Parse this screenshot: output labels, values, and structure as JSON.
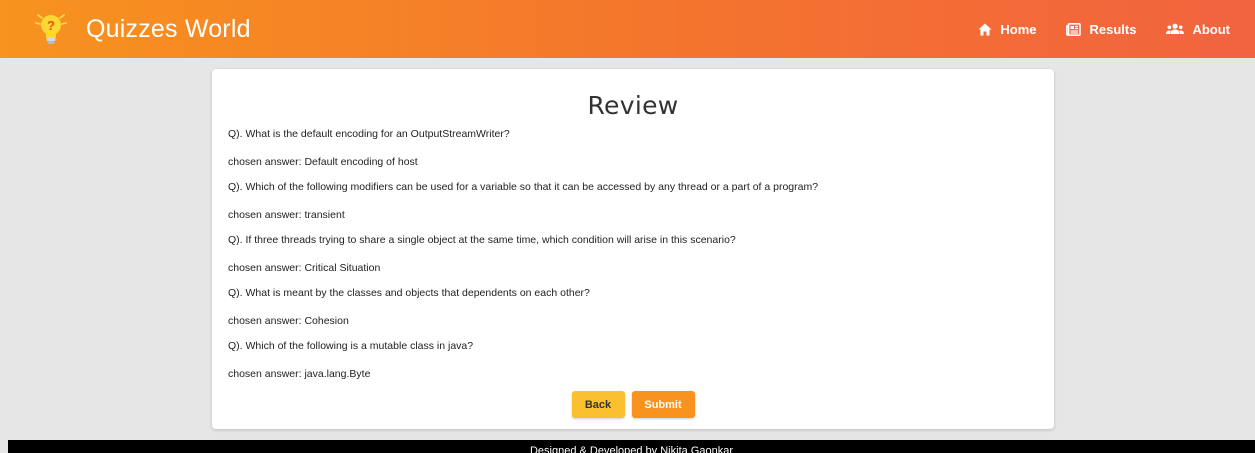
{
  "navbar": {
    "brand": "Quizzes World",
    "logo_icon": "lightbulb-question-icon",
    "links": [
      {
        "label": "Home",
        "icon": "home-icon"
      },
      {
        "label": "Results",
        "icon": "newspaper-icon"
      },
      {
        "label": "About",
        "icon": "users-icon"
      }
    ]
  },
  "review": {
    "title": "Review",
    "items": [
      {
        "question": "Q). What is the default encoding for an OutputStreamWriter?",
        "answer": "chosen answer: Default encoding of host"
      },
      {
        "question": "Q). Which of the following modifiers can be used for a variable so that it can be accessed by any thread or a part of a program?",
        "answer": "chosen answer: transient"
      },
      {
        "question": "Q). If three threads trying to share a single object at the same time, which condition will arise in this scenario?",
        "answer": "chosen answer: Critical Situation"
      },
      {
        "question": "Q). What is meant by the classes and objects that dependents on each other?",
        "answer": "chosen answer: Cohesion"
      },
      {
        "question": "Q). Which of the following is a mutable class in java?",
        "answer": "chosen answer: java.lang.Byte"
      }
    ],
    "back_label": "Back",
    "submit_label": "Submit"
  },
  "footer": {
    "text": "Designed & Developed by Nikita Gaonkar"
  },
  "colors": {
    "navbar_start": "#f7931e",
    "navbar_end": "#f2633f",
    "back_button": "#fbc02d",
    "submit_button": "#f7931e",
    "background": "#e6e6e6"
  }
}
